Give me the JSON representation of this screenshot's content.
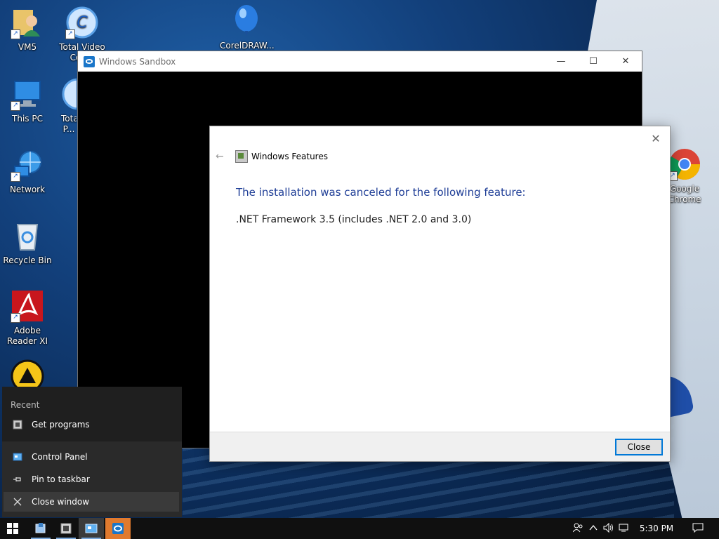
{
  "desktop": {
    "icons": [
      {
        "label": "VM5"
      },
      {
        "label": "Total Video Con..."
      },
      {
        "label": "CorelDRAW..."
      },
      {
        "label": "This PC"
      },
      {
        "label": "Total P..."
      },
      {
        "label": "Network"
      },
      {
        "label": "Recycle Bin"
      },
      {
        "label": "Adobe Reader XI"
      },
      {
        "label": "Google Chrome"
      }
    ]
  },
  "sandbox": {
    "title": "Windows Sandbox",
    "minimize_glyph": "—",
    "maximize_glyph": "☐",
    "close_glyph": "✕"
  },
  "dialog": {
    "title": "Windows Features",
    "back_glyph": "←",
    "close_glyph": "✕",
    "message": "The installation was canceled for the following feature:",
    "feature": ".NET Framework 3.5 (includes .NET 2.0 and 3.0)",
    "close_button": "Close"
  },
  "jumplist": {
    "section": "Recent",
    "items": [
      {
        "label": "Get programs",
        "icon": "program-icon"
      },
      {
        "label": "Control Panel",
        "icon": "control-panel-icon"
      },
      {
        "label": "Pin to taskbar",
        "icon": "pin-icon"
      },
      {
        "label": "Close window",
        "icon": "close-icon"
      }
    ]
  },
  "taskbar": {
    "time": "5:30 PM",
    "colors": {
      "accent": "#e07a2e",
      "active": "#3b3b3b"
    }
  }
}
